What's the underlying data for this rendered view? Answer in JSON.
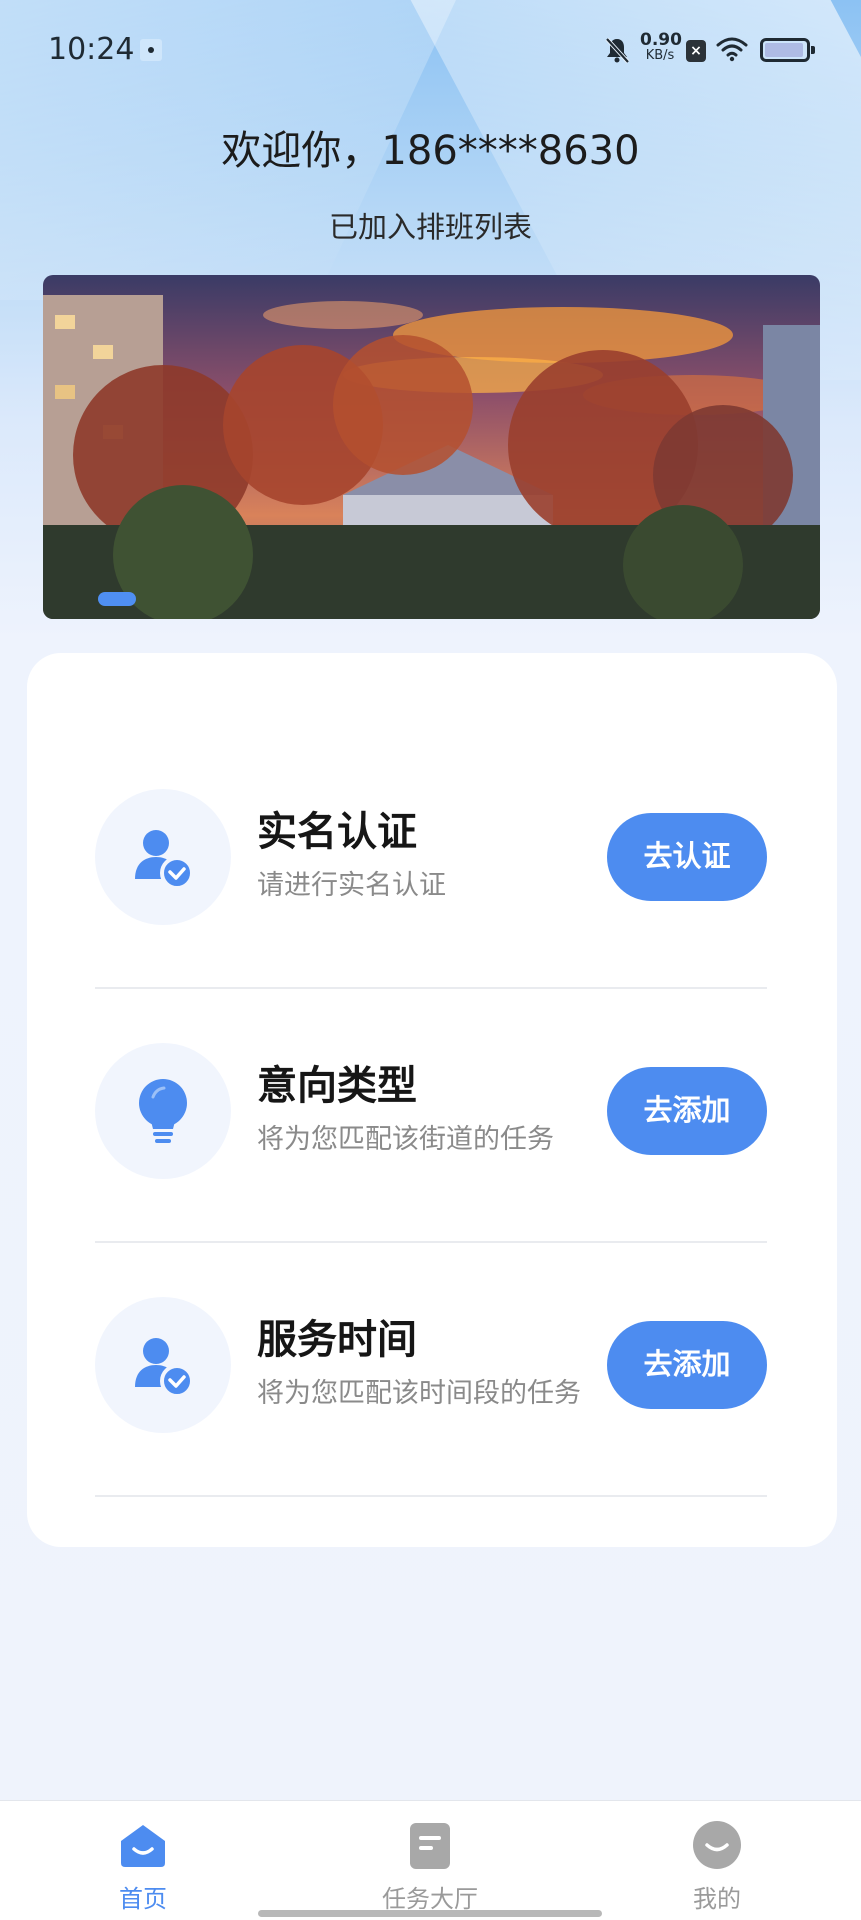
{
  "status_bar": {
    "time": "10:24",
    "net_speed_value": "0.90",
    "net_speed_unit": "KB/s",
    "icons": [
      "sim-card-icon",
      "bell-muted-icon",
      "close-box-icon",
      "wifi-icon",
      "battery-icon"
    ]
  },
  "header": {
    "welcome": "欢迎你，186****8630",
    "status": "已加入排班列表"
  },
  "banner": {
    "active_index": 0
  },
  "tasks": [
    {
      "title": "实名认证",
      "desc": "请进行实名认证",
      "button": "去认证",
      "icon": "user-check-icon"
    },
    {
      "title": "意向类型",
      "desc": "将为您匹配该街道的任务",
      "button": "去添加",
      "icon": "lightbulb-icon"
    },
    {
      "title": "服务时间",
      "desc": "将为您匹配该时间段的任务",
      "button": "去添加",
      "icon": "user-check-icon"
    }
  ],
  "nav": {
    "items": [
      {
        "label": "首页",
        "icon": "home-icon",
        "active": true
      },
      {
        "label": "任务大厅",
        "icon": "task-hall-icon",
        "active": false
      },
      {
        "label": "我的",
        "icon": "profile-icon",
        "active": false
      }
    ]
  },
  "colors": {
    "accent": "#4d8cf0",
    "nav_active": "#4d8cf0",
    "nav_inactive": "#9a9a9a"
  }
}
